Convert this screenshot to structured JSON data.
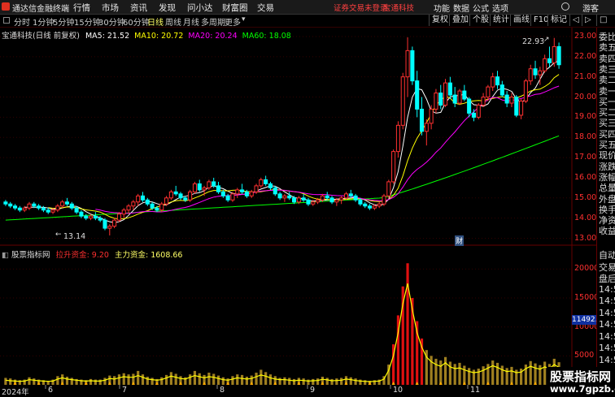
{
  "menubar": {
    "app_title": "通达信金融终端",
    "items": [
      "行情",
      "市场",
      "资讯",
      "发现",
      "问小达",
      "财富圈",
      "交易"
    ],
    "notice": "证券交易未登录",
    "stock_name_red": "宝通科技",
    "right_items": [
      "功能",
      "数据",
      "公式",
      "选项"
    ],
    "guest": "游客"
  },
  "toolbar": {
    "periods": [
      "分时",
      "1分钟",
      "5分钟",
      "15分钟",
      "30分钟",
      "60分钟",
      "日线",
      "周线",
      "月线",
      "多周期",
      "更多"
    ],
    "active_period": "日线",
    "right_buttons": [
      "复权",
      "叠加",
      "个股",
      "统计",
      "画线",
      "F10",
      "标记"
    ]
  },
  "main_legend": {
    "title": "宝通科技(日线 前复权)",
    "ma5": "MA5: 21.52",
    "ma10": "MA10: 20.72",
    "ma20": "MA20: 20.24",
    "ma60": "MA60: 18.08"
  },
  "sub_legend": {
    "title": "股票指标网",
    "item1": "拉升资金: 9.20",
    "item2": "主力资金: 1608.66"
  },
  "price_axis": [
    "23.00",
    "22.00",
    "21.00",
    "20.00",
    "19.00",
    "18.00",
    "17.00",
    "16.00",
    "15.00",
    "14.00",
    "13.00"
  ],
  "volume_axis": [
    "20000",
    "15000",
    "10000",
    "5000"
  ],
  "volume_current": "11492.66",
  "date_axis": [
    "2024年",
    "6",
    "7",
    "8",
    "9",
    "10",
    "11"
  ],
  "annotations": {
    "high": "22.93",
    "low": "13.14",
    "cai": "财"
  },
  "side_panel": {
    "top_items": [
      "委比",
      "卖五",
      "卖四",
      "卖三",
      "卖二",
      "卖一",
      "买一",
      "买二",
      "买三",
      "买四",
      "买五",
      "现价",
      "涨跌",
      "涨幅",
      "总量",
      "外盘",
      "换手",
      "净资",
      "收益"
    ],
    "bottom_items": [
      "自动",
      "交易",
      "盘后",
      "14:5",
      "14:5",
      "14:5",
      "14:5",
      "14:5",
      "14:5",
      "14:5",
      "14:5",
      "14:5"
    ]
  },
  "watermark": {
    "line1": "股票指标网",
    "line2": "www.7gpzb.com"
  },
  "colors": {
    "up": "#ff3030",
    "down": "#00ffff",
    "ma5": "#ffffff",
    "ma10": "#ffff00",
    "ma20": "#ff00ff",
    "ma60": "#00ff00",
    "volume_line": "#ffff00"
  },
  "chart_data": {
    "type": "candlestick",
    "start_date": "2024-05",
    "candles": [
      [
        14.8,
        14.9,
        14.6,
        14.7
      ],
      [
        14.7,
        14.8,
        14.5,
        14.6
      ],
      [
        14.6,
        14.7,
        14.4,
        14.5
      ],
      [
        14.5,
        14.6,
        14.3,
        14.4
      ],
      [
        14.4,
        14.6,
        14.3,
        14.5
      ],
      [
        14.5,
        14.8,
        14.4,
        14.7
      ],
      [
        14.7,
        14.8,
        14.5,
        14.6
      ],
      [
        14.6,
        14.7,
        14.4,
        14.5
      ],
      [
        14.5,
        14.6,
        14.3,
        14.4
      ],
      [
        14.4,
        14.5,
        14.2,
        14.3
      ],
      [
        14.3,
        14.5,
        14.2,
        14.4
      ],
      [
        14.4,
        14.7,
        14.3,
        14.6
      ],
      [
        14.6,
        14.9,
        14.5,
        14.8
      ],
      [
        14.8,
        15.0,
        14.6,
        14.7
      ],
      [
        14.7,
        14.8,
        14.4,
        14.5
      ],
      [
        14.5,
        14.6,
        14.2,
        14.3
      ],
      [
        14.3,
        14.4,
        14.0,
        14.1
      ],
      [
        14.1,
        14.2,
        13.9,
        14.0
      ],
      [
        14.0,
        14.2,
        13.9,
        14.1
      ],
      [
        14.1,
        14.3,
        13.9,
        14.0
      ],
      [
        14.0,
        14.1,
        13.8,
        13.9
      ],
      [
        13.9,
        14.0,
        13.4,
        13.5
      ],
      [
        13.5,
        13.7,
        13.14,
        13.6
      ],
      [
        13.6,
        14.0,
        13.5,
        13.9
      ],
      [
        13.9,
        14.3,
        13.8,
        14.2
      ],
      [
        14.2,
        14.5,
        14.0,
        14.4
      ],
      [
        14.4,
        14.7,
        14.2,
        14.6
      ],
      [
        14.6,
        14.9,
        14.4,
        14.8
      ],
      [
        14.8,
        15.2,
        14.6,
        15.1
      ],
      [
        15.1,
        15.3,
        14.8,
        14.9
      ],
      [
        14.9,
        15.0,
        14.6,
        14.7
      ],
      [
        14.7,
        14.8,
        14.4,
        14.5
      ],
      [
        14.5,
        14.6,
        14.3,
        14.4
      ],
      [
        14.4,
        14.8,
        14.3,
        14.7
      ],
      [
        14.7,
        15.1,
        14.6,
        15.0
      ],
      [
        15.0,
        15.4,
        14.9,
        15.3
      ],
      [
        15.3,
        15.6,
        15.1,
        15.2
      ],
      [
        15.2,
        15.3,
        14.9,
        15.0
      ],
      [
        15.0,
        15.1,
        14.8,
        14.9
      ],
      [
        14.9,
        15.4,
        14.8,
        15.3
      ],
      [
        15.3,
        15.8,
        15.2,
        15.7
      ],
      [
        15.7,
        15.9,
        15.3,
        15.4
      ],
      [
        15.4,
        15.6,
        15.1,
        15.5
      ],
      [
        15.5,
        15.9,
        15.4,
        15.8
      ],
      [
        15.8,
        16.0,
        15.5,
        15.6
      ],
      [
        15.6,
        15.8,
        15.2,
        15.3
      ],
      [
        15.3,
        15.4,
        15.0,
        15.1
      ],
      [
        15.1,
        15.2,
        14.8,
        14.9
      ],
      [
        14.9,
        15.3,
        14.8,
        15.2
      ],
      [
        15.2,
        15.5,
        15.0,
        15.4
      ],
      [
        15.4,
        15.7,
        15.2,
        15.3
      ],
      [
        15.3,
        15.4,
        15.0,
        15.1
      ],
      [
        15.1,
        15.4,
        15.0,
        15.3
      ],
      [
        15.3,
        15.7,
        15.2,
        15.6
      ],
      [
        15.6,
        16.0,
        15.5,
        15.9
      ],
      [
        15.9,
        16.1,
        15.6,
        15.7
      ],
      [
        15.7,
        15.8,
        15.4,
        15.5
      ],
      [
        15.5,
        15.6,
        15.1,
        15.2
      ],
      [
        15.2,
        15.3,
        14.9,
        15.0
      ],
      [
        15.0,
        15.2,
        14.8,
        15.1
      ],
      [
        15.1,
        15.3,
        14.9,
        15.0
      ],
      [
        15.0,
        15.1,
        14.7,
        14.8
      ],
      [
        14.8,
        15.1,
        14.7,
        15.0
      ],
      [
        15.0,
        15.2,
        14.8,
        14.9
      ],
      [
        14.9,
        15.0,
        14.6,
        14.7
      ],
      [
        14.7,
        14.9,
        14.6,
        14.8
      ],
      [
        14.8,
        15.0,
        14.7,
        14.9
      ],
      [
        14.9,
        15.2,
        14.8,
        15.1
      ],
      [
        15.1,
        15.3,
        14.9,
        15.0
      ],
      [
        15.0,
        15.1,
        14.7,
        14.8
      ],
      [
        14.8,
        15.0,
        14.6,
        14.9
      ],
      [
        14.9,
        15.1,
        14.7,
        15.0
      ],
      [
        15.0,
        15.3,
        14.9,
        15.2
      ],
      [
        15.2,
        15.4,
        15.0,
        15.1
      ],
      [
        15.1,
        15.2,
        14.8,
        14.9
      ],
      [
        14.9,
        15.0,
        14.6,
        14.7
      ],
      [
        14.7,
        14.8,
        14.5,
        14.6
      ],
      [
        14.6,
        14.7,
        14.4,
        14.5
      ],
      [
        14.5,
        14.7,
        14.4,
        14.6
      ],
      [
        14.6,
        14.8,
        14.5,
        14.7
      ],
      [
        14.7,
        15.2,
        14.6,
        15.1
      ],
      [
        15.1,
        15.9,
        15.0,
        15.8
      ],
      [
        15.8,
        17.4,
        15.7,
        17.3
      ],
      [
        17.3,
        18.8,
        17.0,
        18.6
      ],
      [
        18.6,
        21.2,
        18.4,
        21.0
      ],
      [
        21.0,
        22.96,
        20.0,
        22.3
      ],
      [
        22.3,
        22.5,
        20.6,
        20.8
      ],
      [
        20.8,
        21.3,
        19.0,
        19.4
      ],
      [
        19.4,
        20.0,
        18.1,
        18.3
      ],
      [
        18.3,
        18.9,
        17.6,
        18.7
      ],
      [
        18.7,
        19.6,
        18.4,
        19.4
      ],
      [
        19.4,
        20.4,
        19.2,
        20.2
      ],
      [
        20.2,
        20.6,
        19.4,
        19.6
      ],
      [
        19.6,
        20.9,
        19.5,
        20.7
      ],
      [
        20.7,
        21.0,
        19.9,
        20.1
      ],
      [
        20.1,
        20.5,
        19.5,
        19.7
      ],
      [
        19.7,
        20.4,
        19.6,
        20.3
      ],
      [
        20.3,
        20.6,
        19.8,
        19.9
      ],
      [
        19.9,
        20.0,
        19.0,
        19.2
      ],
      [
        19.2,
        19.4,
        18.8,
        19.0
      ],
      [
        19.0,
        19.7,
        18.9,
        19.6
      ],
      [
        19.6,
        20.2,
        19.5,
        20.0
      ],
      [
        20.0,
        20.6,
        19.8,
        20.5
      ],
      [
        20.5,
        21.2,
        20.3,
        21.0
      ],
      [
        21.0,
        21.3,
        20.4,
        20.6
      ],
      [
        20.6,
        20.8,
        20.0,
        20.1
      ],
      [
        20.1,
        20.3,
        19.5,
        19.7
      ],
      [
        19.7,
        20.2,
        19.5,
        20.0
      ],
      [
        20.0,
        20.1,
        19.0,
        19.1
      ],
      [
        19.1,
        19.9,
        18.9,
        19.8
      ],
      [
        19.8,
        20.9,
        19.7,
        20.8
      ],
      [
        20.8,
        21.6,
        20.6,
        21.4
      ],
      [
        21.4,
        21.8,
        20.9,
        21.1
      ],
      [
        21.1,
        21.5,
        20.6,
        21.3
      ],
      [
        21.3,
        22.1,
        21.2,
        21.9
      ],
      [
        21.9,
        22.5,
        21.5,
        21.7
      ],
      [
        21.7,
        22.93,
        21.5,
        22.5
      ],
      [
        22.5,
        22.7,
        21.4,
        21.6
      ]
    ],
    "ma60_start": 13.9,
    "ma60_end": 18.08,
    "volume": [
      1200,
      1100,
      900,
      800,
      900,
      1300,
      1100,
      900,
      800,
      700,
      900,
      1500,
      1800,
      1400,
      1200,
      1000,
      900,
      800,
      1000,
      900,
      900,
      1200,
      1600,
      1500,
      1800,
      2000,
      1800,
      1900,
      2400,
      1800,
      1400,
      1200,
      1000,
      1300,
      1700,
      2200,
      1900,
      1500,
      1300,
      1800,
      2400,
      2000,
      1700,
      2100,
      1900,
      1600,
      1300,
      1100,
      1500,
      1800,
      1700,
      1400,
      1600,
      2100,
      2600,
      2200,
      1800,
      1500,
      1200,
      1300,
      1200,
      1000,
      1200,
      1100,
      900,
      1000,
      1100,
      1400,
      1200,
      1000,
      1100,
      1200,
      1500,
      1300,
      1100,
      900,
      800,
      700,
      800,
      900,
      1500,
      3500,
      7000,
      12000,
      17000,
      21000,
      15000,
      11000,
      8000,
      6000,
      5000,
      4500,
      4200,
      4800,
      4000,
      3600,
      3800,
      3300,
      2900,
      2600,
      2800,
      3200,
      3600,
      4200,
      3800,
      3300,
      2900,
      3100,
      2600,
      2800,
      3500,
      4100,
      3700,
      3400,
      4000,
      3600,
      4500,
      3900
    ],
    "volume_line": [
      800,
      700,
      650,
      600,
      650,
      900,
      800,
      700,
      650,
      600,
      650,
      1000,
      1200,
      1000,
      900,
      800,
      700,
      650,
      700,
      650,
      650,
      800,
      1100,
      1000,
      1200,
      1400,
      1300,
      1300,
      1600,
      1300,
      1000,
      900,
      800,
      900,
      1200,
      1500,
      1300,
      1100,
      1000,
      1300,
      1600,
      1400,
      1200,
      1400,
      1300,
      1100,
      900,
      800,
      1000,
      1200,
      1100,
      1000,
      1100,
      1400,
      1700,
      1500,
      1200,
      1000,
      900,
      900,
      800,
      700,
      800,
      750,
      650,
      700,
      750,
      950,
      850,
      700,
      750,
      800,
      1000,
      900,
      750,
      650,
      600,
      550,
      600,
      650,
      1000,
      2500,
      5000,
      9000,
      14000,
      17500,
      13000,
      9000,
      6500,
      4800,
      4000,
      3500,
      3200,
      3800,
      3100,
      2800,
      2900,
      2600,
      2300,
      2100,
      2200,
      2500,
      2900,
      3300,
      3000,
      2600,
      2300,
      2400,
      2100,
      2200,
      2800,
      3200,
      2900,
      2700,
      3100,
      2800,
      3500,
      3000
    ]
  }
}
